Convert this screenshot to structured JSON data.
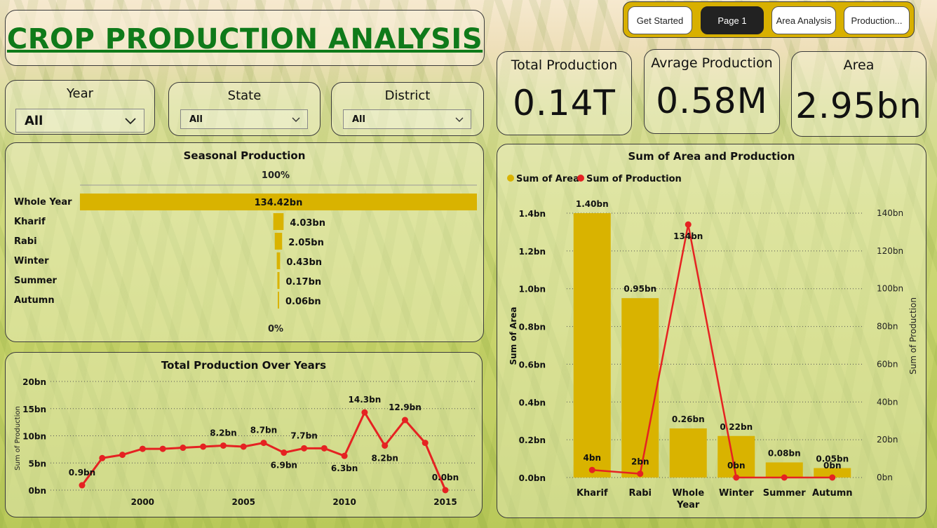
{
  "header": {
    "title": "CROP PRODUCTION ANALYSIS"
  },
  "nav": [
    {
      "label": "Get Started",
      "active": false
    },
    {
      "label": "Page 1",
      "active": true
    },
    {
      "label": "Area Analysis",
      "active": false
    },
    {
      "label": "Production...",
      "active": false
    }
  ],
  "filters": {
    "year": {
      "label": "Year",
      "value": "All"
    },
    "state": {
      "label": "State",
      "value": "All"
    },
    "district": {
      "label": "District",
      "value": "All"
    }
  },
  "kpis": {
    "total_production": {
      "label": "Total Production",
      "value": "0.14T"
    },
    "average_production": {
      "label": "Avrage Production",
      "value": "0.58M"
    },
    "area": {
      "label": "Area",
      "value": "2.95bn"
    }
  },
  "colors": {
    "gold": "#d9b300",
    "red": "#e52222",
    "title_green": "#0f7a1a"
  },
  "chart_data": [
    {
      "id": "seasonal",
      "type": "bar",
      "title": "Seasonal Production",
      "top_label": "100%",
      "bottom_label": "0%",
      "categories": [
        "Whole Year",
        "Kharif",
        "Rabi",
        "Winter",
        "Summer",
        "Autumn"
      ],
      "values": [
        134.42,
        4.03,
        2.05,
        0.43,
        0.17,
        0.06
      ],
      "labels": [
        "134.42bn",
        "4.03bn",
        "2.05bn",
        "0.43bn",
        "0.17bn",
        "0.06bn"
      ]
    },
    {
      "id": "years",
      "type": "line",
      "title": "Total Production Over Years",
      "ylabel": "Sum of Production",
      "ylim": [
        0,
        20
      ],
      "yticks": [
        "0bn",
        "5bn",
        "10bn",
        "15bn",
        "20bn"
      ],
      "xticks": [
        "2000",
        "2005",
        "2010",
        "2015"
      ],
      "x": [
        1997,
        1998,
        1999,
        2000,
        2001,
        2002,
        2003,
        2004,
        2005,
        2006,
        2007,
        2008,
        2009,
        2010,
        2011,
        2012,
        2013,
        2014,
        2015
      ],
      "values": [
        0.9,
        5.9,
        6.5,
        7.6,
        7.6,
        7.8,
        8.0,
        8.2,
        8.0,
        8.7,
        6.9,
        7.7,
        7.7,
        6.3,
        14.3,
        8.2,
        12.9,
        8.7,
        0.0
      ],
      "point_labels": [
        {
          "x": 1997,
          "text": "0.9bn",
          "pos": "above"
        },
        {
          "x": 2004,
          "text": "8.2bn",
          "pos": "above"
        },
        {
          "x": 2006,
          "text": "8.7bn",
          "pos": "above"
        },
        {
          "x": 2007,
          "text": "6.9bn",
          "pos": "below"
        },
        {
          "x": 2008,
          "text": "7.7bn",
          "pos": "above"
        },
        {
          "x": 2010,
          "text": "6.3bn",
          "pos": "below"
        },
        {
          "x": 2011,
          "text": "14.3bn",
          "pos": "above"
        },
        {
          "x": 2012,
          "text": "8.2bn",
          "pos": "below"
        },
        {
          "x": 2013,
          "text": "12.9bn",
          "pos": "above"
        },
        {
          "x": 2015,
          "text": "0.0bn",
          "pos": "above"
        }
      ]
    },
    {
      "id": "area_production",
      "type": "bar",
      "title": "Sum of Area and Production",
      "legend": [
        "Sum of Area",
        "Sum of Production"
      ],
      "xlabel": "",
      "ylabel_left": "Sum of Area",
      "ylabel_right": "Sum of Production",
      "categories": [
        "Kharif",
        "Rabi",
        "Whole Year",
        "Winter",
        "Summer",
        "Autumn"
      ],
      "series": [
        {
          "name": "Sum of Area",
          "type": "bar",
          "values": [
            1.4,
            0.95,
            0.26,
            0.22,
            0.08,
            0.05
          ],
          "labels": [
            "1.40bn",
            "0.95bn",
            "0.26bn",
            "0.22bn",
            "0.08bn",
            "0.05bn"
          ]
        },
        {
          "name": "Sum of Production",
          "type": "line",
          "values": [
            4,
            2,
            134,
            0,
            0,
            0
          ],
          "labels": [
            "4bn",
            "2bn",
            "134bn",
            "0bn",
            "",
            "0bn"
          ]
        }
      ],
      "ylim_left": [
        0,
        1.4
      ],
      "yticks_left": [
        "0.0bn",
        "0.2bn",
        "0.4bn",
        "0.6bn",
        "0.8bn",
        "1.0bn",
        "1.2bn",
        "1.4bn"
      ],
      "ylim_right": [
        0,
        140
      ],
      "yticks_right": [
        "0bn",
        "20bn",
        "40bn",
        "60bn",
        "80bn",
        "100bn",
        "120bn",
        "140bn"
      ]
    }
  ]
}
